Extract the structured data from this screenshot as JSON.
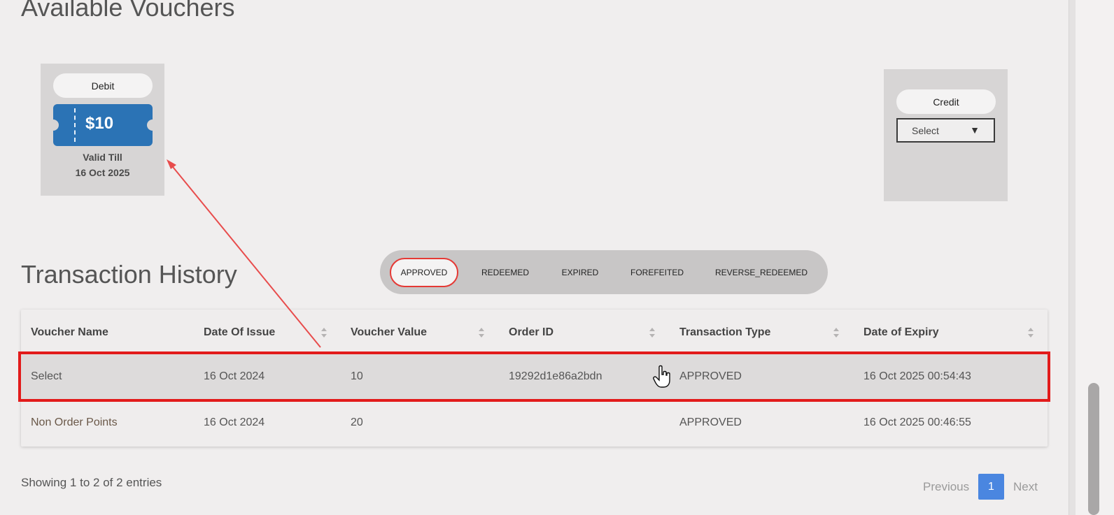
{
  "vouchers": {
    "title": "Available Vouchers",
    "debit_card": {
      "label": "Debit",
      "amount": "$10",
      "valid_till_label": "Valid Till",
      "valid_till_date": "16 Oct 2025"
    },
    "credit_card": {
      "label": "Credit",
      "select_value": "Select"
    }
  },
  "history": {
    "title": "Transaction History",
    "tabs": [
      {
        "label": "APPROVED",
        "active": true
      },
      {
        "label": "REDEEMED",
        "active": false
      },
      {
        "label": "EXPIRED",
        "active": false
      },
      {
        "label": "FOREFEITED",
        "active": false
      },
      {
        "label": "REVERSE_REDEEMED",
        "active": false
      }
    ],
    "columns": [
      "Voucher Name",
      "Date Of Issue",
      "Voucher Value",
      "Order ID",
      "Transaction Type",
      "Date of Expiry"
    ],
    "rows": [
      [
        "Select",
        "16 Oct 2024",
        "10",
        "19292d1e86a2bdn",
        "APPROVED",
        "16 Oct 2025 00:54:43"
      ],
      [
        "Non Order Points",
        "16 Oct 2024",
        "20",
        "",
        "APPROVED",
        "16 Oct 2025 00:46:55"
      ]
    ],
    "showing": "Showing 1 to 2 of 2 entries",
    "pagination": {
      "previous": "Previous",
      "page": "1",
      "next": "Next"
    }
  },
  "colors": {
    "ticket_blue": "#2b73b5",
    "annotation_red": "#e21b1b",
    "page_active": "#4a86e0"
  }
}
